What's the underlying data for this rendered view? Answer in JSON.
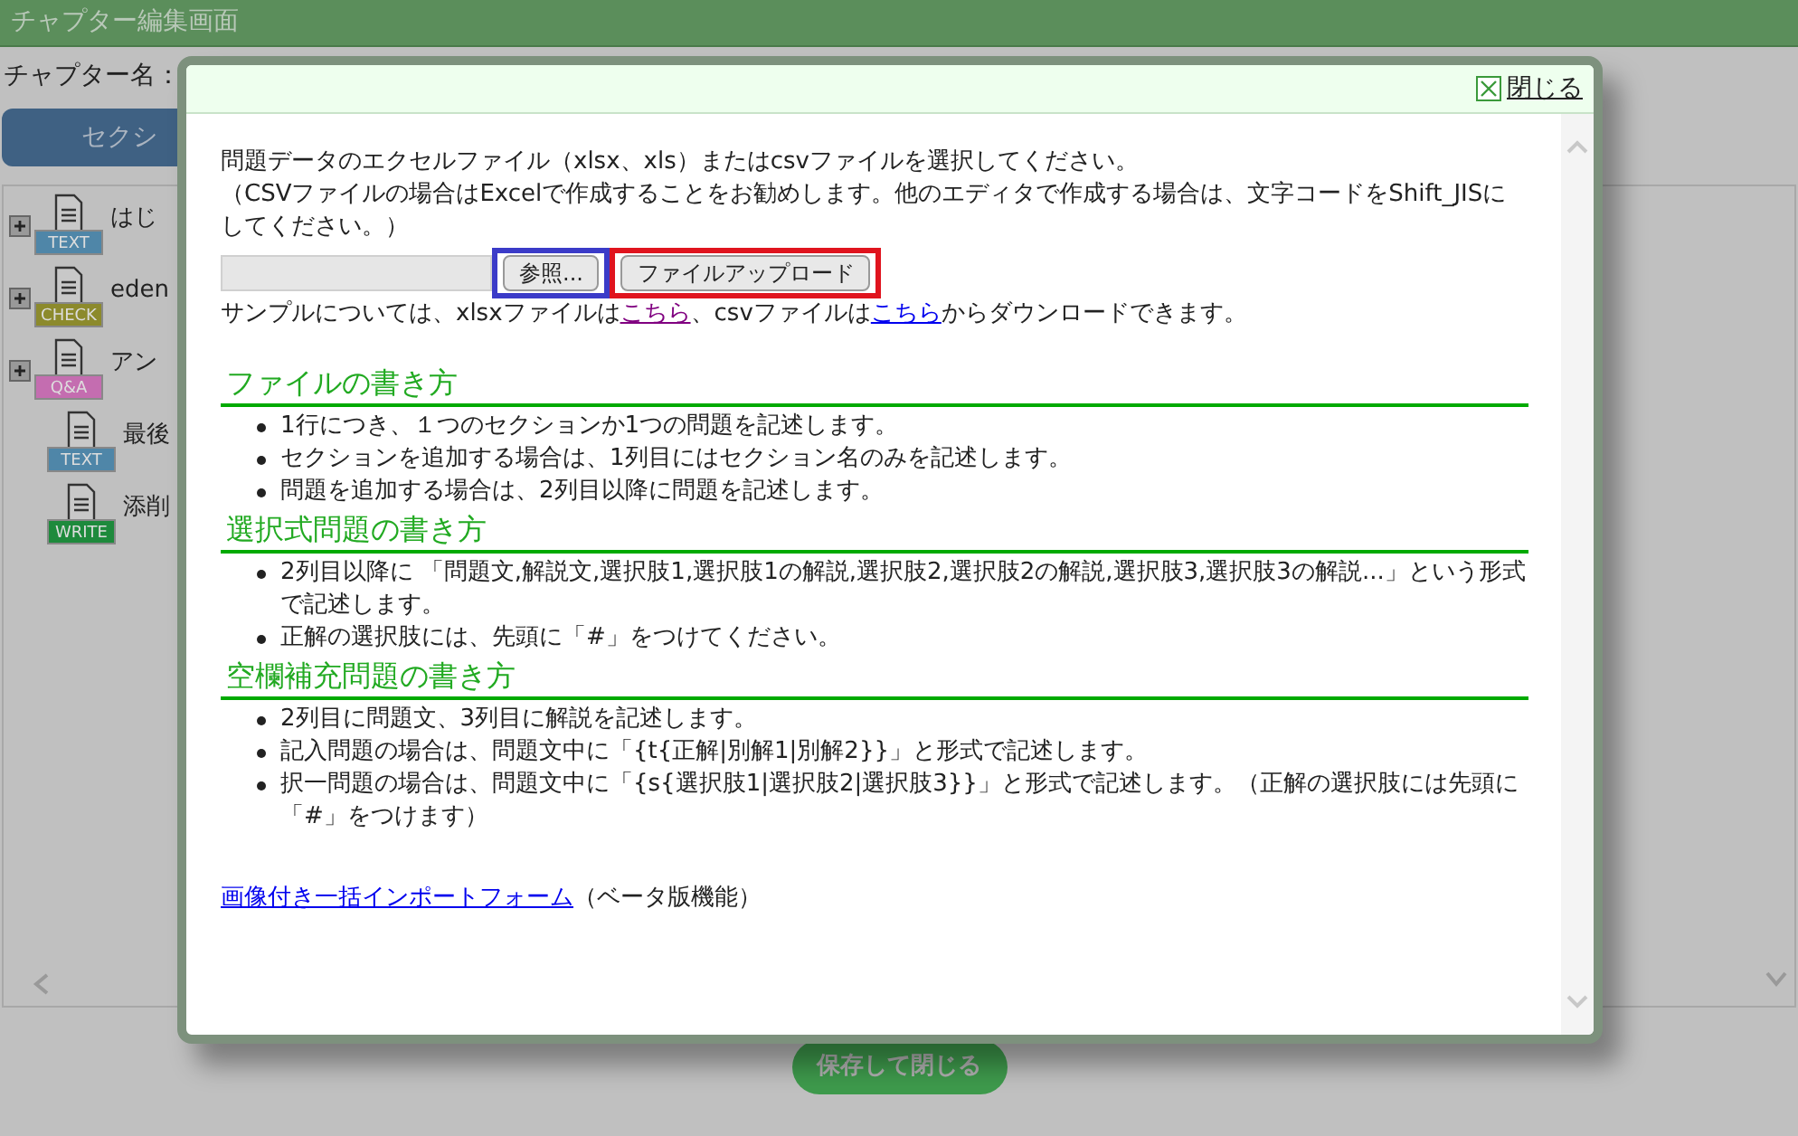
{
  "header": {
    "title": "チャプター編集画面"
  },
  "chapter_name_label": "チャプター名：",
  "section_button": "セクシ",
  "tree": [
    {
      "label": "はじ",
      "expanded": false,
      "badge": "TEXT",
      "color": "#4f86a8"
    },
    {
      "label": "eden",
      "expanded": false,
      "badge": "CHECK",
      "color": "#8c8a2c"
    },
    {
      "label": "アン",
      "expanded": false,
      "badge": "Q&A",
      "color": "#c46db0"
    },
    {
      "label": "最後",
      "badge": "TEXT",
      "color": "#4f86a8"
    },
    {
      "label": "添削",
      "badge": "WRITE",
      "color": "#1e8a3c"
    }
  ],
  "save_button": "保存して閉じる",
  "dialog": {
    "close": "閉じる",
    "intro": "問題データのエクセルファイル（xlsx、xls）またはcsvファイルを選択してください。",
    "note": "（CSVファイルの場合はExcelで作成することをお勧めします。他のエディタで作成する場合は、文字コードをShift_JISにしてください。）",
    "file_buttons": [
      {
        "label": "参照...",
        "color": "#3b3bc8"
      },
      {
        "label": "ファイルアップロード",
        "color": "#e0141e"
      }
    ],
    "sample": [
      {
        "kind": "text",
        "text": "サンプルについては、xlsxファイルは"
      },
      {
        "kind": "link",
        "text": "こちら",
        "visited": true
      },
      {
        "kind": "text",
        "text": "、csvファイルは"
      },
      {
        "kind": "link",
        "text": "こちら",
        "visited": false
      },
      {
        "kind": "text",
        "text": "からダウンロードできます。"
      }
    ],
    "sections": [
      {
        "heading": "ファイルの書き方",
        "items": [
          "1行につき、１つのセクションか1つの問題を記述します。",
          "セクションを追加する場合は、1列目にはセクション名のみを記述します。",
          "問題を追加する場合は、2列目以降に問題を記述します。"
        ]
      },
      {
        "heading": "選択式問題の書き方",
        "items": [
          "2列目以降に 「問題文,解説文,選択肢1,選択肢1の解説,選択肢2,選択肢2の解説,選択肢3,選択肢3の解説...」という形式で記述します。",
          "正解の選択肢には、先頭に「#」をつけてください。"
        ]
      },
      {
        "heading": "空欄補充問題の書き方",
        "items": [
          "2列目に問題文、3列目に解説を記述します。",
          "記入問題の場合は、問題文中に「{t{正解|別解1|別解2}}」と形式で記述します。",
          "択一問題の場合は、問題文中に「{s{選択肢1|選択肢2|選択肢3}}」と形式で記述します。（正解の選択肢には先頭に「#」をつけます）"
        ]
      }
    ],
    "import_link": "画像付き一括インポートフォーム",
    "import_note": "（ベータ版機能）"
  }
}
